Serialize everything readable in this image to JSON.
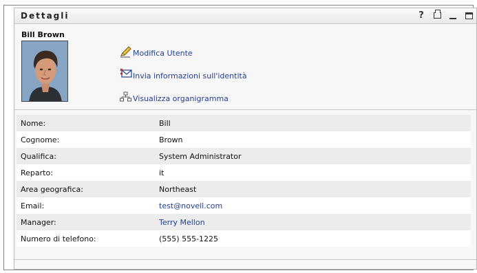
{
  "portlet": {
    "title": "Dettagli",
    "controls": [
      "help-icon",
      "print-icon",
      "minimize-icon",
      "maximize-icon"
    ]
  },
  "user": {
    "name": "Bill Brown",
    "photo_icon": "user-photo"
  },
  "actions": [
    {
      "label": "Modifica Utente",
      "icon": "pencil-icon"
    },
    {
      "label": "Invia informazioni sull'identità",
      "icon": "envelope-icon"
    },
    {
      "label": "Visualizza organigramma",
      "icon": "org-chart-icon"
    }
  ],
  "details": [
    {
      "label": "Nome:",
      "value": "Bill",
      "link": false
    },
    {
      "label": "Cognome:",
      "value": "Brown",
      "link": false
    },
    {
      "label": "Qualifica:",
      "value": "System Administrator",
      "link": false
    },
    {
      "label": "Reparto:",
      "value": "it",
      "link": false
    },
    {
      "label": "Area geografica:",
      "value": "Northeast",
      "link": false
    },
    {
      "label": "Email:",
      "value": "test@novell.com",
      "link": true
    },
    {
      "label": "Manager:",
      "value": "Terry Mellon",
      "link": true
    },
    {
      "label": "Numero di telefono:",
      "value": "(555) 555-1225",
      "link": false
    }
  ],
  "colors": {
    "link": "#1f3f8f",
    "row_alt": "#ececec",
    "panel_bg": "#f7f7f7"
  }
}
